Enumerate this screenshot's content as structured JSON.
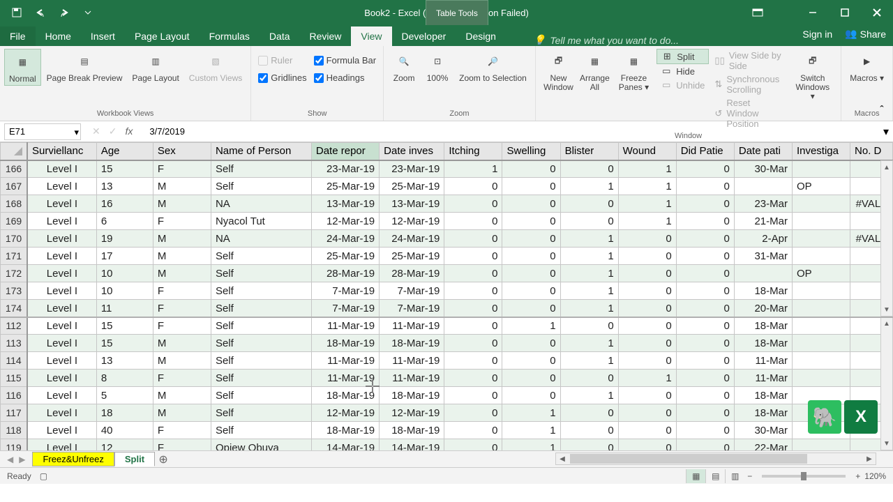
{
  "titlebar": {
    "title": "Book2 - Excel (Product Activation Failed)",
    "table_tools": "Table Tools"
  },
  "tabs": {
    "file": "File",
    "home": "Home",
    "insert": "Insert",
    "page_layout": "Page Layout",
    "formulas": "Formulas",
    "data": "Data",
    "review": "Review",
    "view": "View",
    "developer": "Developer",
    "design": "Design",
    "tell_me": "Tell me what you want to do...",
    "sign_in": "Sign in",
    "share": "Share"
  },
  "ribbon": {
    "views": {
      "normal": "Normal",
      "page_break": "Page Break Preview",
      "page_layout": "Page Layout",
      "custom": "Custom Views",
      "group": "Workbook Views"
    },
    "show": {
      "ruler": "Ruler",
      "formula_bar": "Formula Bar",
      "gridlines": "Gridlines",
      "headings": "Headings",
      "group": "Show"
    },
    "zoom": {
      "zoom": "Zoom",
      "pct": "100%",
      "selection": "Zoom to Selection",
      "group": "Zoom"
    },
    "window": {
      "new": "New Window",
      "arrange": "Arrange All",
      "freeze": "Freeze Panes",
      "split": "Split",
      "hide": "Hide",
      "unhide": "Unhide",
      "side": "View Side by Side",
      "sync": "Synchronous Scrolling",
      "reset": "Reset Window Position",
      "switch": "Switch Windows",
      "group": "Window"
    },
    "macros": {
      "macros": "Macros",
      "group": "Macros"
    }
  },
  "formula_bar": {
    "name_box": "E71",
    "formula": "3/7/2019"
  },
  "columns": {
    "surv": "Surviellanc",
    "age": "Age",
    "sex": "Sex",
    "name": "Name of Person",
    "drep": "Date repor",
    "dinv": "Date inves",
    "itch": "Itching",
    "swell": "Swelling",
    "blist": "Blister",
    "wound": "Wound",
    "didp": "Did Patie",
    "datep": "Date pati",
    "inves": "Investiga",
    "nod": "No. D"
  },
  "rows_top": [
    {
      "r": "166",
      "surv": "Level I",
      "age": "15",
      "sex": "F",
      "name": "Self",
      "drep": "23-Mar-19",
      "dinv": "23-Mar-19",
      "itch": "1",
      "swell": "0",
      "blist": "0",
      "wound": "1",
      "didp": "0",
      "datep": "30-Mar",
      "inves": "",
      "nod": ""
    },
    {
      "r": "167",
      "surv": "Level I",
      "age": "13",
      "sex": "M",
      "name": "Self",
      "drep": "25-Mar-19",
      "dinv": "25-Mar-19",
      "itch": "0",
      "swell": "0",
      "blist": "1",
      "wound": "1",
      "didp": "0",
      "datep": "",
      "inves": "OP",
      "nod": ""
    },
    {
      "r": "168",
      "surv": "Level I",
      "age": "16",
      "sex": "M",
      "name": "NA",
      "drep": "13-Mar-19",
      "dinv": "13-Mar-19",
      "itch": "0",
      "swell": "0",
      "blist": "0",
      "wound": "1",
      "didp": "0",
      "datep": "23-Mar",
      "inves": "",
      "nod": "#VALU"
    },
    {
      "r": "169",
      "surv": "Level I",
      "age": "6",
      "sex": "F",
      "name": "Nyacol Tut",
      "drep": "12-Mar-19",
      "dinv": "12-Mar-19",
      "itch": "0",
      "swell": "0",
      "blist": "0",
      "wound": "1",
      "didp": "0",
      "datep": "21-Mar",
      "inves": "",
      "nod": ""
    },
    {
      "r": "170",
      "surv": "Level I",
      "age": "19",
      "sex": "M",
      "name": "NA",
      "drep": "24-Mar-19",
      "dinv": "24-Mar-19",
      "itch": "0",
      "swell": "0",
      "blist": "1",
      "wound": "0",
      "didp": "0",
      "datep": "2-Apr",
      "inves": "",
      "nod": "#VALU"
    },
    {
      "r": "171",
      "surv": "Level I",
      "age": "17",
      "sex": "M",
      "name": "Self",
      "drep": "25-Mar-19",
      "dinv": "25-Mar-19",
      "itch": "0",
      "swell": "0",
      "blist": "1",
      "wound": "0",
      "didp": "0",
      "datep": "31-Mar",
      "inves": "",
      "nod": ""
    },
    {
      "r": "172",
      "surv": "Level I",
      "age": "10",
      "sex": "M",
      "name": "Self",
      "drep": "28-Mar-19",
      "dinv": "28-Mar-19",
      "itch": "0",
      "swell": "0",
      "blist": "1",
      "wound": "0",
      "didp": "0",
      "datep": "",
      "inves": "OP",
      "nod": ""
    },
    {
      "r": "173",
      "surv": "Level I",
      "age": "10",
      "sex": "F",
      "name": "Self",
      "drep": "7-Mar-19",
      "dinv": "7-Mar-19",
      "itch": "0",
      "swell": "0",
      "blist": "1",
      "wound": "0",
      "didp": "0",
      "datep": "18-Mar",
      "inves": "",
      "nod": ""
    },
    {
      "r": "174",
      "surv": "Level I",
      "age": "11",
      "sex": "F",
      "name": "Self",
      "drep": "7-Mar-19",
      "dinv": "7-Mar-19",
      "itch": "0",
      "swell": "0",
      "blist": "1",
      "wound": "0",
      "didp": "0",
      "datep": "20-Mar",
      "inves": "",
      "nod": ""
    }
  ],
  "rows_bot": [
    {
      "r": "112",
      "surv": "Level I",
      "age": "15",
      "sex": "F",
      "name": "Self",
      "drep": "11-Mar-19",
      "dinv": "11-Mar-19",
      "itch": "0",
      "swell": "1",
      "blist": "0",
      "wound": "0",
      "didp": "0",
      "datep": "18-Mar",
      "inves": "",
      "nod": ""
    },
    {
      "r": "113",
      "surv": "Level I",
      "age": "15",
      "sex": "M",
      "name": "Self",
      "drep": "18-Mar-19",
      "dinv": "18-Mar-19",
      "itch": "0",
      "swell": "0",
      "blist": "1",
      "wound": "0",
      "didp": "0",
      "datep": "18-Mar",
      "inves": "",
      "nod": ""
    },
    {
      "r": "114",
      "surv": "Level I",
      "age": "13",
      "sex": "M",
      "name": "Self",
      "drep": "11-Mar-19",
      "dinv": "11-Mar-19",
      "itch": "0",
      "swell": "0",
      "blist": "1",
      "wound": "0",
      "didp": "0",
      "datep": "11-Mar",
      "inves": "",
      "nod": ""
    },
    {
      "r": "115",
      "surv": "Level I",
      "age": "8",
      "sex": "F",
      "name": "Self",
      "drep": "11-Mar-19",
      "dinv": "11-Mar-19",
      "itch": "0",
      "swell": "0",
      "blist": "0",
      "wound": "1",
      "didp": "0",
      "datep": "11-Mar",
      "inves": "",
      "nod": ""
    },
    {
      "r": "116",
      "surv": "Level I",
      "age": "5",
      "sex": "M",
      "name": "Self",
      "drep": "18-Mar-19",
      "dinv": "18-Mar-19",
      "itch": "0",
      "swell": "0",
      "blist": "1",
      "wound": "0",
      "didp": "0",
      "datep": "18-Mar",
      "inves": "",
      "nod": ""
    },
    {
      "r": "117",
      "surv": "Level I",
      "age": "18",
      "sex": "M",
      "name": "Self",
      "drep": "12-Mar-19",
      "dinv": "12-Mar-19",
      "itch": "0",
      "swell": "1",
      "blist": "0",
      "wound": "0",
      "didp": "0",
      "datep": "18-Mar",
      "inves": "",
      "nod": ""
    },
    {
      "r": "118",
      "surv": "Level I",
      "age": "40",
      "sex": "F",
      "name": "Self",
      "drep": "18-Mar-19",
      "dinv": "18-Mar-19",
      "itch": "0",
      "swell": "1",
      "blist": "0",
      "wound": "0",
      "didp": "0",
      "datep": "30-Mar",
      "inves": "",
      "nod": ""
    },
    {
      "r": "119",
      "surv": "Level I",
      "age": "12",
      "sex": "F",
      "name": "Opiew Obuya",
      "drep": "14-Mar-19",
      "dinv": "14-Mar-19",
      "itch": "0",
      "swell": "1",
      "blist": "0",
      "wound": "0",
      "didp": "0",
      "datep": "22-Mar",
      "inves": "",
      "nod": ""
    }
  ],
  "sheets": {
    "s1": "Freez&Unfreez",
    "s2": "Split"
  },
  "status": {
    "ready": "Ready",
    "zoom": "120%"
  }
}
